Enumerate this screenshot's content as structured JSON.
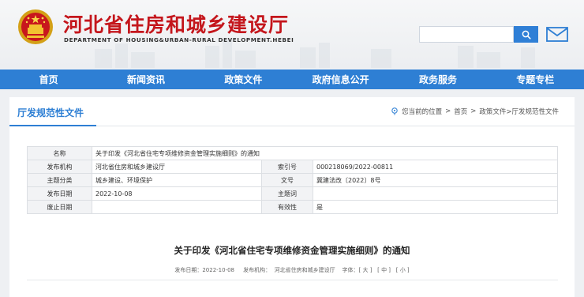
{
  "header": {
    "site_title": "河北省住房和城乡建设厅",
    "site_subtitle": "DEPARTMENT OF HOUSING&URBAN-RURAL DEVELOPMENT.HEBEI",
    "search_placeholder": "",
    "search_icon": "search-icon",
    "mail_icon": "mail-icon"
  },
  "nav": {
    "items": [
      "首页",
      "新闻资讯",
      "政策文件",
      "政府信息公开",
      "政务服务",
      "专题专栏"
    ]
  },
  "section": {
    "title": "厅发规范性文件",
    "breadcrumb": {
      "prefix": "您当前的位置",
      "sep": ">",
      "home": "首页",
      "path": "政策文件>厅发规范性文件"
    }
  },
  "meta_table": {
    "name_label": "名称",
    "name_value": "关于印发《河北省住宅专项维修资金管理实施细则》的通知",
    "issuer_label": "发布机构",
    "issuer_value": "河北省住房和城乡建设厅",
    "index_label": "索引号",
    "index_value": "000218069/2022-00811",
    "category_label": "主题分类",
    "category_value": "城乡建设、环境保护",
    "docno_label": "文号",
    "docno_value": "冀建法改〔2022〕8号",
    "date_label": "发布日期",
    "date_value": "2022-10-08",
    "keywords_label": "主题词",
    "keywords_value": "",
    "expire_label": "废止日期",
    "expire_value": "",
    "valid_label": "有效性",
    "valid_value": "是"
  },
  "document": {
    "title": "关于印发《河北省住宅专项维修资金管理实施细则》的通知",
    "info": {
      "date_label": "发布日期：",
      "date_value": "2022-10-08",
      "org_label": "发布机构：",
      "org_value": "河北省住房和城乡建设厅",
      "font_label": "字体：",
      "font_large": "[ 大 ]",
      "font_medium": "[ 中 ]",
      "font_small": "[ 小 ]"
    }
  },
  "colors": {
    "brand_red": "#c4161c",
    "nav_blue": "#2e7fd4"
  }
}
